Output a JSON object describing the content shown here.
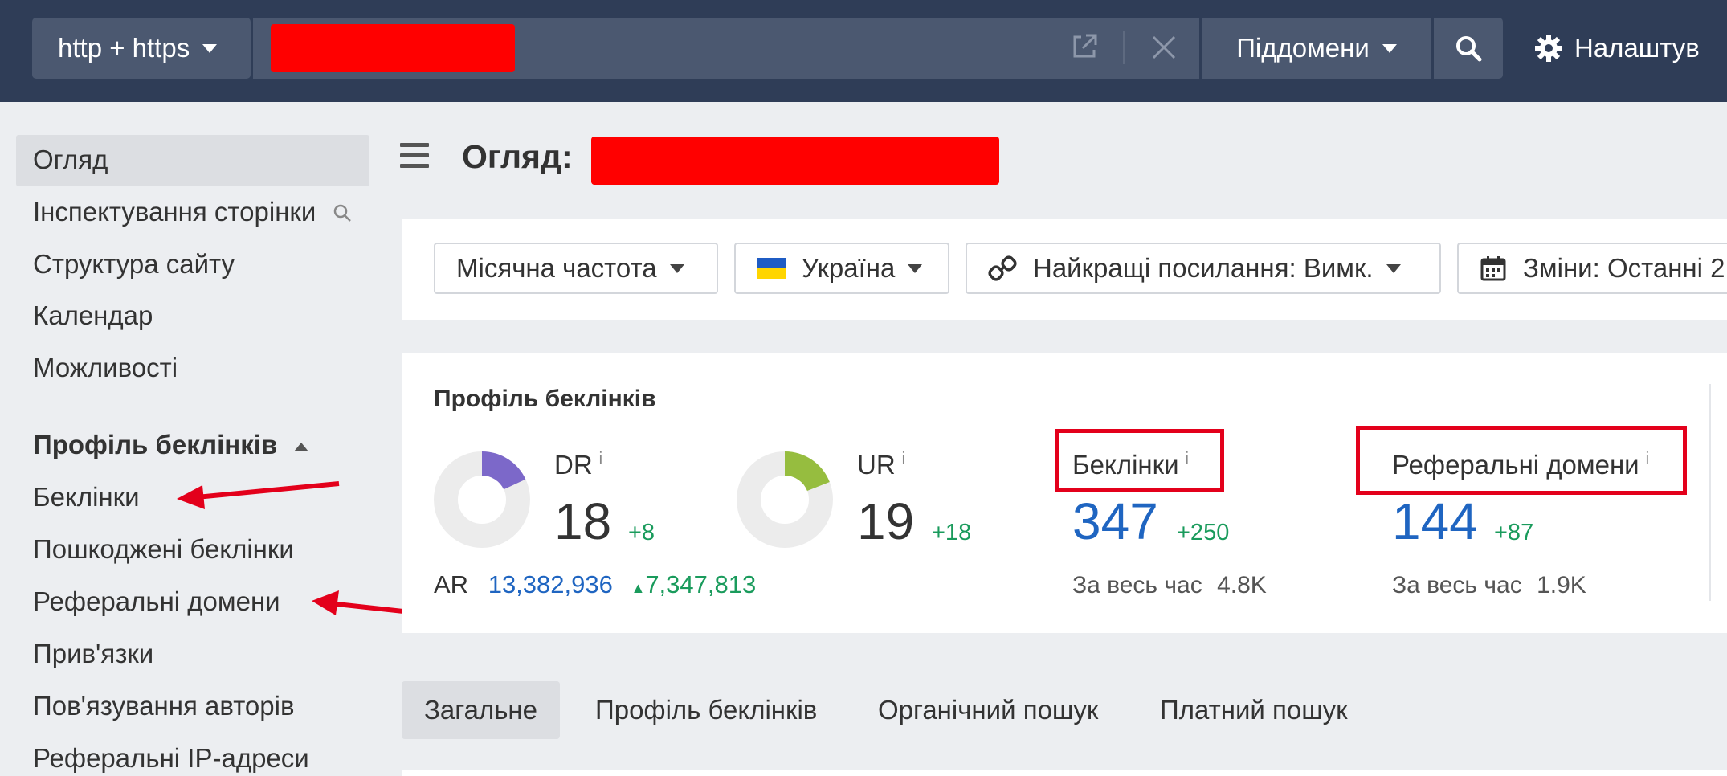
{
  "header": {
    "protocol_label": "http + https",
    "subdomains_label": "Піддомени",
    "settings_label": "Налаштув"
  },
  "sidebar": {
    "items": [
      {
        "label": "Огляд"
      },
      {
        "label": "Інспектування сторінки"
      },
      {
        "label": "Структура сайту"
      },
      {
        "label": "Календар"
      },
      {
        "label": "Можливості"
      }
    ],
    "section_title": "Профіль беклінків",
    "section_items": [
      {
        "label": "Беклінки"
      },
      {
        "label": "Пошкоджені беклінки"
      },
      {
        "label": "Реферальні домени"
      },
      {
        "label": "Прив'язки"
      },
      {
        "label": "Пов'язування авторів"
      },
      {
        "label": "Реферальні IP-адреси"
      }
    ]
  },
  "main": {
    "title": "Огляд:",
    "filters": {
      "frequency": "Місячна частота",
      "country": "Україна",
      "best_links": "Найкращі посилання: Вимк.",
      "changes": "Зміни: Останні 2"
    },
    "card": {
      "title": "Профіль беклінків",
      "dr": {
        "label": "DR",
        "info": "i",
        "value": "18",
        "delta": "+8",
        "ring_fraction": 0.18,
        "ring_color": "#7c68c9"
      },
      "ur": {
        "label": "UR",
        "info": "i",
        "value": "19",
        "delta": "+18",
        "ring_fraction": 0.19,
        "ring_color": "#96bd3f"
      },
      "ar": {
        "label": "AR",
        "value": "13,382,936",
        "delta": "7,347,813"
      },
      "backlinks": {
        "label": "Беклінки",
        "info": "i",
        "value": "347",
        "delta": "+250",
        "alltime_label": "За весь час",
        "alltime_value": "4.8K"
      },
      "refdomains": {
        "label": "Реферальні домени",
        "info": "i",
        "value": "144",
        "delta": "+87",
        "alltime_label": "За весь час",
        "alltime_value": "1.9K"
      }
    },
    "tabs": [
      {
        "label": "Загальне"
      },
      {
        "label": "Профіль беклінків"
      },
      {
        "label": "Органічний пошук"
      },
      {
        "label": "Платний пошук"
      }
    ]
  },
  "colors": {
    "topbar": "#2f3d57",
    "accent_blue": "#1f65c1",
    "delta_green": "#1a9b5c",
    "annotation_red": "#e3001b"
  }
}
